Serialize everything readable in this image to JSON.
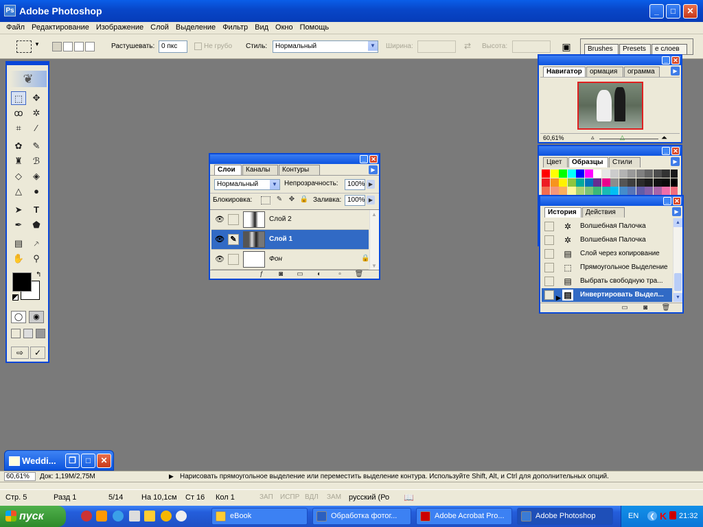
{
  "window": {
    "title": "Adobe Photoshop",
    "controls": [
      "minimize",
      "maximize",
      "close"
    ]
  },
  "menu": [
    "Файл",
    "Редактирование",
    "Изображение",
    "Слой",
    "Выделение",
    "Фильтр",
    "Вид",
    "Окно",
    "Помощь"
  ],
  "options": {
    "feather_label": "Растушевать:",
    "feather_value": "0 пкс",
    "antialias_label": "Не грубо",
    "style_label": "Стиль:",
    "style_value": "Нормальный",
    "width_label": "Ширина:",
    "height_label": "Высота:"
  },
  "palette_well": {
    "tabs": [
      "Brushes",
      "Presets",
      "е слоев"
    ]
  },
  "navigator": {
    "tabs": [
      "Навигатор",
      "ормация",
      "ограмма"
    ],
    "zoom": "60,61%"
  },
  "swatches": {
    "tabs": [
      "Цвет",
      "Образцы",
      "Стили"
    ],
    "colors": [
      "#ff0000",
      "#ffff00",
      "#00ff00",
      "#00ffff",
      "#0000ff",
      "#ff00ff",
      "#ffffff",
      "#e6e6e6",
      "#cccccc",
      "#b3b3b3",
      "#999999",
      "#808080",
      "#666666",
      "#4d4d4d",
      "#333333",
      "#1a1a1a",
      "#ed1c24",
      "#f7941d",
      "#fff200",
      "#8dc63f",
      "#00a99d",
      "#0072bc",
      "#662d91",
      "#ec008c",
      "#8c8c8c",
      "#555555",
      "#3f3f3f",
      "#2b2b2b",
      "#1c1c1c",
      "#111111",
      "#0a0a0a",
      "#000000",
      "#f26c4f",
      "#f69679",
      "#fbaf5d",
      "#fff799",
      "#acd373",
      "#7cc576",
      "#3bb878",
      "#1abbb4",
      "#00bff3",
      "#448ccb",
      "#5674b9",
      "#605ca8",
      "#8560a8",
      "#a864a8",
      "#f06ea9",
      "#f26d7d"
    ]
  },
  "history": {
    "tabs": [
      "История",
      "Действия"
    ],
    "items": [
      {
        "label": "Волшебная Палочка",
        "icon": "magic-wand-icon"
      },
      {
        "label": "Волшебная Палочка",
        "icon": "magic-wand-icon"
      },
      {
        "label": "Слой через копирование",
        "icon": "document-icon"
      },
      {
        "label": "Прямоугольное Выделение",
        "icon": "marquee-icon"
      },
      {
        "label": "Выбрать свободную тра...",
        "icon": "document-icon"
      },
      {
        "label": "Инвертировать Выдел...",
        "icon": "document-icon"
      }
    ]
  },
  "layers": {
    "tabs": [
      "Слои",
      "Каналы",
      "Контуры"
    ],
    "blend_mode": "Нормальный",
    "opacity_label": "Непрозрачность:",
    "opacity_value": "100%",
    "lock_label": "Блокировка:",
    "fill_label": "Заливка:",
    "fill_value": "100%",
    "items": [
      {
        "name": "Слой 2",
        "selected": false
      },
      {
        "name": "Слой 1",
        "selected": true
      },
      {
        "name": "Фон",
        "selected": false
      }
    ]
  },
  "minimized_doc": {
    "title": "Weddi..."
  },
  "doc_status": {
    "zoom": "60,61%",
    "doc_size": "Док: 1,19M/2,75M",
    "hint": "Нарисовать прямоугольное выделение или переместить выделение контура.  Используйте Shift, Alt, и Ctrl для дополнительных опций."
  },
  "word_status": {
    "page": "Стр. 5",
    "section": "Разд 1",
    "pages": "5/14",
    "at": "На 10,1см",
    "line": "Ст 16",
    "col": "Кол 1",
    "rec": "ЗАП",
    "trk": "ИСПР",
    "ext": "ВДЛ",
    "ovr": "ЗАМ",
    "lang": "русский (Ро"
  },
  "taskbar": {
    "start": "пуск",
    "tasks": [
      "eBook",
      "Обработка фотог...",
      "Adobe Acrobat Pro...",
      "Adobe Photoshop"
    ],
    "lang": "EN",
    "clock": "21:32"
  }
}
